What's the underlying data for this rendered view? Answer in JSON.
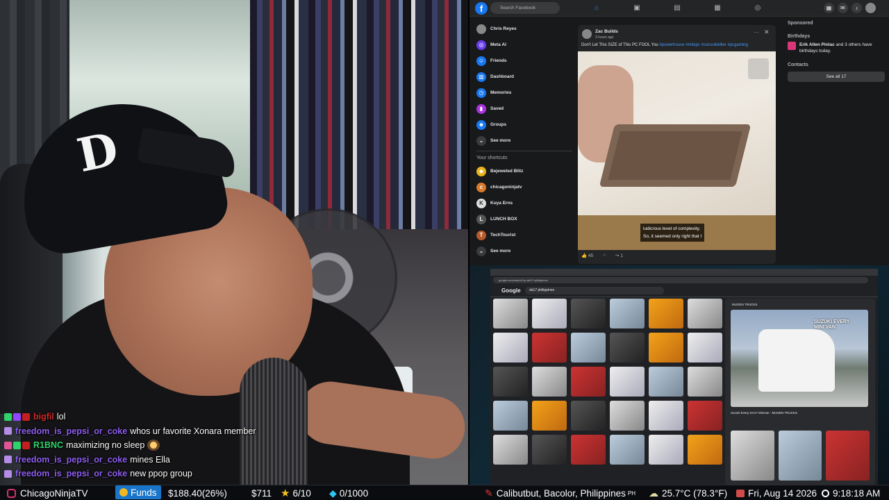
{
  "chat": [
    {
      "user": "bigfil",
      "message": "lol",
      "user_color": "#cf2a2a",
      "badges": [
        "b-green",
        "b-purple",
        "b-red"
      ]
    },
    {
      "user": "freedom_is_pepsi_or_coke",
      "message": "whos ur favorite Xonara member",
      "user_color": "#8e5df0",
      "badges": [
        "b-lav"
      ]
    },
    {
      "user": "R1BNC",
      "message": "maximizing no sleep",
      "user_color": "#2ed46b",
      "badges": [
        "b-pink",
        "b-green",
        "b-red"
      ],
      "emote": true
    },
    {
      "user": "freedom_is_pepsi_or_coke",
      "message": "mines Ella",
      "user_color": "#8e5df0",
      "badges": [
        "b-lav"
      ]
    },
    {
      "user": "freedom_is_pepsi_or_coke",
      "message": "new ppop group",
      "user_color": "#8e5df0",
      "badges": [
        "b-lav"
      ]
    }
  ],
  "facebook": {
    "search_placeholder": "Search Facebook",
    "left_menu": [
      {
        "label": "Chris Reyes",
        "icon": "profile-avatar-icon"
      },
      {
        "label": "Meta AI",
        "icon": "meta-ai-icon"
      },
      {
        "label": "Friends",
        "icon": "friends-icon"
      },
      {
        "label": "Dashboard",
        "icon": "dashboard-icon"
      },
      {
        "label": "Memories",
        "icon": "memories-icon"
      },
      {
        "label": "Saved",
        "icon": "saved-icon"
      },
      {
        "label": "Groups",
        "icon": "groups-icon"
      },
      {
        "label": "See more",
        "icon": "chevron-down-icon"
      }
    ],
    "shortcuts_title": "Your shortcuts",
    "shortcuts": [
      {
        "label": "Bejeweled Blitz"
      },
      {
        "label": "chicagoninjatv"
      },
      {
        "label": "Kuya Erns"
      },
      {
        "label": "LUNCH BOX"
      },
      {
        "label": "TechTourist"
      },
      {
        "label": "See more"
      }
    ],
    "post": {
      "author": "Zac Builds",
      "time": "3 hours ago",
      "text": "Don't Let This SIZE of This PC FOOL You",
      "hashtags": "#powerhouse #mitxpc #consolekiller #pcgaming",
      "caption_line1": "ludicrous level of complexity.",
      "caption_line2": "So, it seemed only right that I",
      "likes": "45",
      "shares": "1"
    },
    "right": {
      "sponsored": "Sponsored",
      "birthdays_title": "Birthdays",
      "birthday_name": "Erik Allen Pinlac",
      "birthday_rest": "and 3 others have birthdays today.",
      "contacts": "Contacts",
      "see_all": "See all 17"
    },
    "accent_color": "#1877f2"
  },
  "browser": {
    "address": "google.com/search?q=da17+philippines",
    "search_query": "da17 philippines",
    "preview_source": "MUGEN TRUCKS",
    "preview_label_line1": "SUZUKI EVERY",
    "preview_label_line2": "MINI VAN",
    "preview_caption": "Suzuki Every DA17 Minivan - MUGEN TRUCKS"
  },
  "bottombar": {
    "channel": "ChicagoNinjaTV",
    "funds_label": "Funds",
    "funds_value": "$188.40(26%)",
    "dollar_value": "$711",
    "stars": "6/10",
    "gems": "0/1000",
    "location": "Calibutbut, Bacolor, Philippines",
    "location_suffix": "PH",
    "weather": "25.7°C (78.3°F)",
    "date": "Fri, Aug 14 2026",
    "time": "9:18:18 AM"
  }
}
